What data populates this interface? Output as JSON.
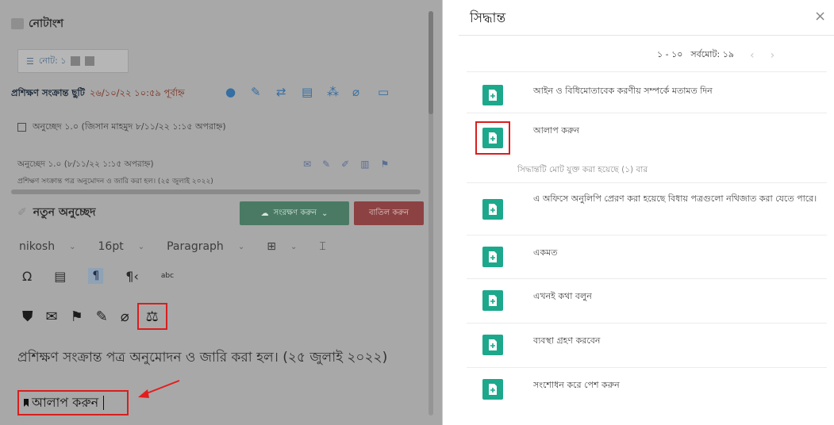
{
  "left": {
    "panel_title": "নোটাংশ",
    "note_tab_label": "নোট: ১",
    "subject": "প্রশিক্ষণ সংক্রান্ত ছুটি",
    "subject_date": "২৬/১০/২২ ১০:৫৯ পূর্বাহ্ন",
    "paragraph_row": "অনুচ্ছেদ ১.০ (জিসান মাহমুদ ৮/১১/২২ ১:১৫ অপরাহ্ন)",
    "paragraph2_title": "অনুচ্ছেদ ১.০ (৮/১১/২২ ১:১৫ অপরাহ্ন)",
    "paragraph2_body": "প্রশিক্ষণ সংক্রান্ত পত্র অনুমোদন ও জারি করা হল। (২৫ জুলাই ২০২২)",
    "new_paragraph_title": "নতুন অনুচ্ছেদ",
    "save_button": "সংরক্ষণ করুন",
    "cancel_button": "বাতিল করুন",
    "font_family": "nikosh",
    "font_size": "16pt",
    "block_format": "Paragraph",
    "body_text": "প্রশিক্ষণ সংক্রান্ত পত্র অনুমোদন ও জারি করা হল। (২৫ জুলাই ২০২২)",
    "inserted_text": "আলাপ করুন"
  },
  "right": {
    "title": "সিদ্ধান্ত",
    "close": "×",
    "pager": {
      "range": "১ - ১০",
      "total": "সর্বমোট: ১৯"
    },
    "items": [
      {
        "text": "আইন ও বিধিমোতাবেক করণীয় সম্পর্কে মতামত দিন"
      },
      {
        "text": "আলাপ করুন",
        "sub": "সিদ্ধান্তটি মোট যুক্ত করা হয়েছে (১) বার"
      },
      {
        "text": "এ অফিসে অনুলিপি প্রেরণ করা হয়েছে বিধায় পত্রগুলো নথিজাত করা যেতে পারে।"
      },
      {
        "text": "একমত"
      },
      {
        "text": "এখনই কথা বলুন"
      },
      {
        "text": "ব্যবস্থা গ্রহণ করবেন"
      },
      {
        "text": "সংশোধন করে পেশ করুন"
      }
    ]
  },
  "colors": {
    "badge": "#1da88c",
    "highlight": "#d91e1e"
  }
}
